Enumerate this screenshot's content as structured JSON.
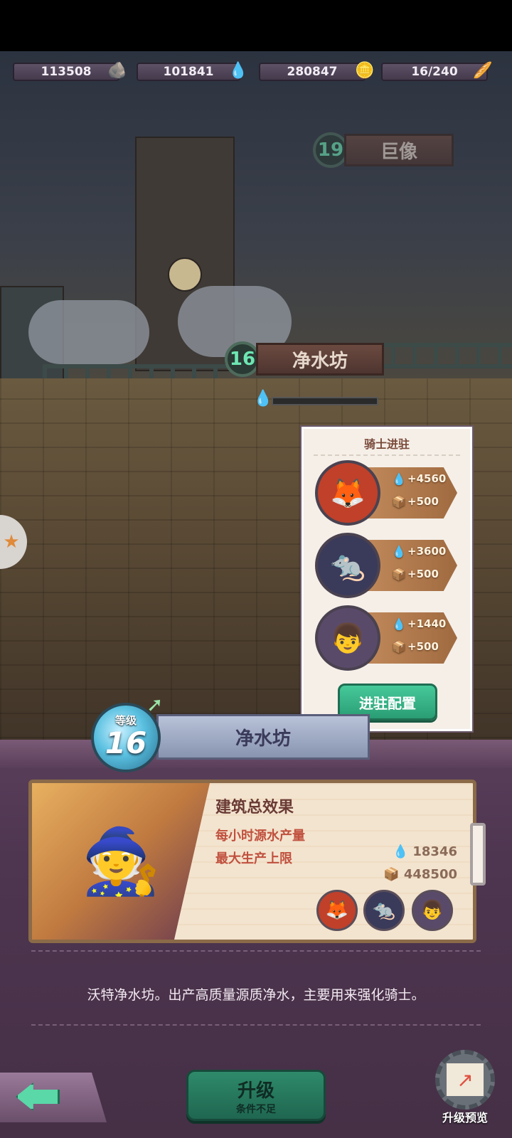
{
  "resources": [
    {
      "value": "113508",
      "icon": "stone-icon"
    },
    {
      "value": "101841",
      "icon": "water-drop-icon"
    },
    {
      "value": "280847",
      "icon": "gold-coin-icon"
    },
    {
      "value": "16/240",
      "icon": "bread-icon"
    }
  ],
  "map": {
    "statue": {
      "level": "19",
      "name": "巨像"
    },
    "water_building": {
      "level": "16",
      "name": "净水坊"
    }
  },
  "knight_panel": {
    "title": "骑士进驻",
    "knights": [
      {
        "water_bonus": "+4560",
        "storage_bonus": "+500"
      },
      {
        "water_bonus": "+3600",
        "storage_bonus": "+500"
      },
      {
        "water_bonus": "+1440",
        "storage_bonus": "+500"
      }
    ],
    "config_button": "进驻配置"
  },
  "building": {
    "level_label": "等级",
    "level": "16",
    "name": "净水坊"
  },
  "effects": {
    "heading": "建筑总效果",
    "hourly_label": "每小时源水产量",
    "hourly_value": "18346",
    "max_label": "最大生产上限",
    "max_value": "448500"
  },
  "description": "沃特净水坊。出产高质量源质净水，主要用来强化骑士。",
  "bottom": {
    "upgrade_label": "升级",
    "upgrade_sub": "条件不足",
    "preview_label": "升级预览"
  },
  "colors": {
    "accent_green": "#2a9d74",
    "panel_purple": "#4e3550",
    "stat_red": "#c0503e"
  }
}
